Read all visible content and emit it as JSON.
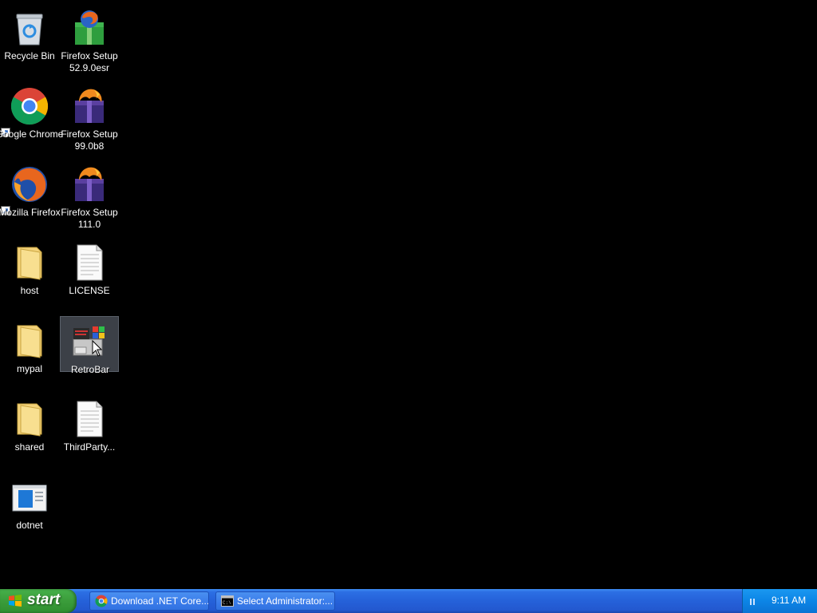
{
  "desktop": {
    "icons": [
      {
        "id": "recycle-bin",
        "label": "Recycle Bin"
      },
      {
        "id": "firefox-setup-52",
        "label": "Firefox Setup 52.9.0esr"
      },
      {
        "id": "google-chrome",
        "label": "Google Chrome"
      },
      {
        "id": "firefox-setup-99",
        "label": "Firefox Setup 99.0b8"
      },
      {
        "id": "mozilla-firefox",
        "label": "Mozilla Firefox"
      },
      {
        "id": "firefox-setup-111",
        "label": "Firefox Setup 111.0"
      },
      {
        "id": "host",
        "label": "host"
      },
      {
        "id": "license",
        "label": "LICENSE"
      },
      {
        "id": "mypal",
        "label": "mypal"
      },
      {
        "id": "retrobar",
        "label": "RetroBar",
        "selected": true
      },
      {
        "id": "shared",
        "label": "shared"
      },
      {
        "id": "thirdparty",
        "label": "ThirdParty..."
      },
      {
        "id": "dotnet",
        "label": "dotnet"
      }
    ]
  },
  "taskbar": {
    "start_label": "start",
    "tasks": [
      {
        "label": "Download .NET Core...",
        "icon": "chrome-icon"
      },
      {
        "label": "Select Administrator:...",
        "icon": "cmd-icon"
      }
    ],
    "clock": "9:11 AM"
  },
  "colors": {
    "desktop_bg": "#000000",
    "taskbar_blue": "#2561d9",
    "start_green": "#3c9e3c",
    "tray_blue": "#0c85e6"
  }
}
